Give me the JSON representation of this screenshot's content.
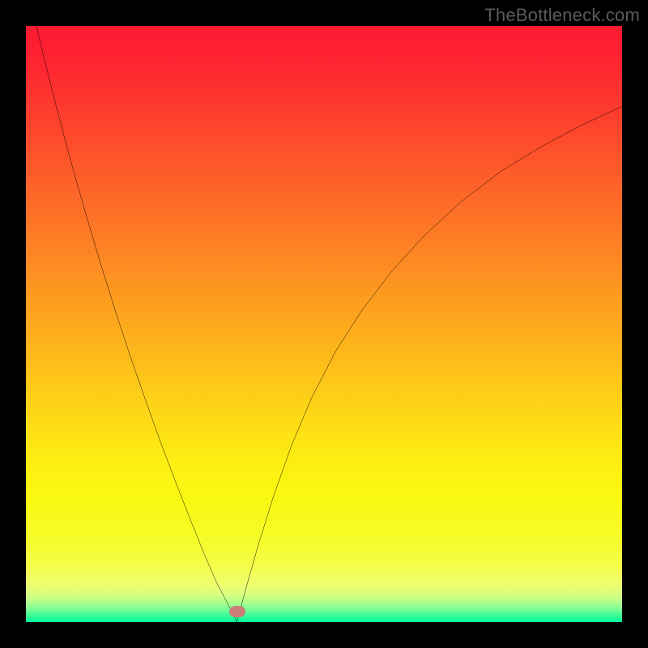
{
  "watermark": "TheBottleneck.com",
  "marker": {
    "x_frac": 0.354,
    "y_frac": 0.982,
    "color": "#cb7c77"
  },
  "gradient_stops": [
    {
      "offset": 0.0,
      "color": "#fe1a32"
    },
    {
      "offset": 0.06,
      "color": "#fe2431"
    },
    {
      "offset": 0.15,
      "color": "#fd3e2d"
    },
    {
      "offset": 0.25,
      "color": "#fd5d29"
    },
    {
      "offset": 0.35,
      "color": "#fd7b25"
    },
    {
      "offset": 0.45,
      "color": "#fd9a1f"
    },
    {
      "offset": 0.55,
      "color": "#fdb81b"
    },
    {
      "offset": 0.65,
      "color": "#fdd716"
    },
    {
      "offset": 0.73,
      "color": "#fdee11"
    },
    {
      "offset": 0.8,
      "color": "#faf913"
    },
    {
      "offset": 0.86,
      "color": "#f6fc29"
    },
    {
      "offset": 0.905,
      "color": "#f3fd48"
    },
    {
      "offset": 0.935,
      "color": "#effe6c"
    },
    {
      "offset": 0.955,
      "color": "#d7fe82"
    },
    {
      "offset": 0.968,
      "color": "#acfe8d"
    },
    {
      "offset": 0.978,
      "color": "#7cfd94"
    },
    {
      "offset": 0.988,
      "color": "#42fc97"
    },
    {
      "offset": 1.0,
      "color": "#01fb97"
    }
  ],
  "chart_data": {
    "type": "line",
    "title": "",
    "xlabel": "",
    "ylabel": "",
    "xlim": [
      0,
      1
    ],
    "ylim": [
      0,
      1
    ],
    "series": [
      {
        "name": "curve-left",
        "x": [
          0.0,
          0.025,
          0.05,
          0.075,
          0.1,
          0.125,
          0.15,
          0.175,
          0.2,
          0.225,
          0.25,
          0.275,
          0.3,
          0.32,
          0.34,
          0.354
        ],
        "y": [
          1.08,
          0.968,
          0.868,
          0.774,
          0.686,
          0.602,
          0.522,
          0.446,
          0.374,
          0.304,
          0.238,
          0.174,
          0.112,
          0.066,
          0.028,
          0.0
        ]
      },
      {
        "name": "curve-right",
        "x": [
          0.354,
          0.37,
          0.39,
          0.415,
          0.445,
          0.48,
          0.52,
          0.565,
          0.615,
          0.67,
          0.73,
          0.795,
          0.865,
          0.935,
          1.0
        ],
        "y": [
          0.0,
          0.06,
          0.13,
          0.21,
          0.295,
          0.378,
          0.455,
          0.525,
          0.59,
          0.65,
          0.705,
          0.755,
          0.798,
          0.835,
          0.865
        ]
      }
    ],
    "marker_point": {
      "x": 0.354,
      "y": 0.018
    }
  }
}
